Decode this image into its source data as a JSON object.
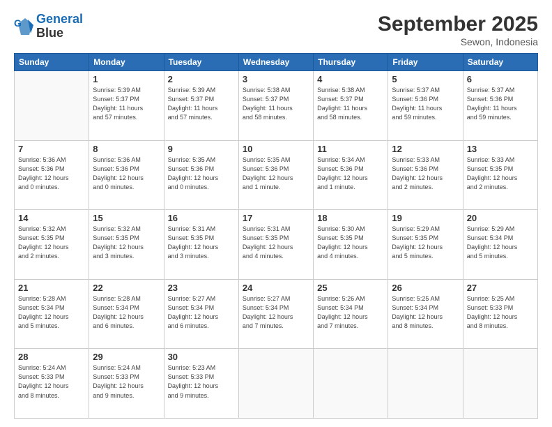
{
  "header": {
    "logo_line1": "General",
    "logo_line2": "Blue",
    "month": "September 2025",
    "location": "Sewon, Indonesia"
  },
  "weekdays": [
    "Sunday",
    "Monday",
    "Tuesday",
    "Wednesday",
    "Thursday",
    "Friday",
    "Saturday"
  ],
  "weeks": [
    [
      {
        "day": "",
        "info": ""
      },
      {
        "day": "1",
        "info": "Sunrise: 5:39 AM\nSunset: 5:37 PM\nDaylight: 11 hours\nand 57 minutes."
      },
      {
        "day": "2",
        "info": "Sunrise: 5:39 AM\nSunset: 5:37 PM\nDaylight: 11 hours\nand 57 minutes."
      },
      {
        "day": "3",
        "info": "Sunrise: 5:38 AM\nSunset: 5:37 PM\nDaylight: 11 hours\nand 58 minutes."
      },
      {
        "day": "4",
        "info": "Sunrise: 5:38 AM\nSunset: 5:37 PM\nDaylight: 11 hours\nand 58 minutes."
      },
      {
        "day": "5",
        "info": "Sunrise: 5:37 AM\nSunset: 5:36 PM\nDaylight: 11 hours\nand 59 minutes."
      },
      {
        "day": "6",
        "info": "Sunrise: 5:37 AM\nSunset: 5:36 PM\nDaylight: 11 hours\nand 59 minutes."
      }
    ],
    [
      {
        "day": "7",
        "info": "Sunrise: 5:36 AM\nSunset: 5:36 PM\nDaylight: 12 hours\nand 0 minutes."
      },
      {
        "day": "8",
        "info": "Sunrise: 5:36 AM\nSunset: 5:36 PM\nDaylight: 12 hours\nand 0 minutes."
      },
      {
        "day": "9",
        "info": "Sunrise: 5:35 AM\nSunset: 5:36 PM\nDaylight: 12 hours\nand 0 minutes."
      },
      {
        "day": "10",
        "info": "Sunrise: 5:35 AM\nSunset: 5:36 PM\nDaylight: 12 hours\nand 1 minute."
      },
      {
        "day": "11",
        "info": "Sunrise: 5:34 AM\nSunset: 5:36 PM\nDaylight: 12 hours\nand 1 minute."
      },
      {
        "day": "12",
        "info": "Sunrise: 5:33 AM\nSunset: 5:36 PM\nDaylight: 12 hours\nand 2 minutes."
      },
      {
        "day": "13",
        "info": "Sunrise: 5:33 AM\nSunset: 5:35 PM\nDaylight: 12 hours\nand 2 minutes."
      }
    ],
    [
      {
        "day": "14",
        "info": "Sunrise: 5:32 AM\nSunset: 5:35 PM\nDaylight: 12 hours\nand 2 minutes."
      },
      {
        "day": "15",
        "info": "Sunrise: 5:32 AM\nSunset: 5:35 PM\nDaylight: 12 hours\nand 3 minutes."
      },
      {
        "day": "16",
        "info": "Sunrise: 5:31 AM\nSunset: 5:35 PM\nDaylight: 12 hours\nand 3 minutes."
      },
      {
        "day": "17",
        "info": "Sunrise: 5:31 AM\nSunset: 5:35 PM\nDaylight: 12 hours\nand 4 minutes."
      },
      {
        "day": "18",
        "info": "Sunrise: 5:30 AM\nSunset: 5:35 PM\nDaylight: 12 hours\nand 4 minutes."
      },
      {
        "day": "19",
        "info": "Sunrise: 5:29 AM\nSunset: 5:35 PM\nDaylight: 12 hours\nand 5 minutes."
      },
      {
        "day": "20",
        "info": "Sunrise: 5:29 AM\nSunset: 5:34 PM\nDaylight: 12 hours\nand 5 minutes."
      }
    ],
    [
      {
        "day": "21",
        "info": "Sunrise: 5:28 AM\nSunset: 5:34 PM\nDaylight: 12 hours\nand 5 minutes."
      },
      {
        "day": "22",
        "info": "Sunrise: 5:28 AM\nSunset: 5:34 PM\nDaylight: 12 hours\nand 6 minutes."
      },
      {
        "day": "23",
        "info": "Sunrise: 5:27 AM\nSunset: 5:34 PM\nDaylight: 12 hours\nand 6 minutes."
      },
      {
        "day": "24",
        "info": "Sunrise: 5:27 AM\nSunset: 5:34 PM\nDaylight: 12 hours\nand 7 minutes."
      },
      {
        "day": "25",
        "info": "Sunrise: 5:26 AM\nSunset: 5:34 PM\nDaylight: 12 hours\nand 7 minutes."
      },
      {
        "day": "26",
        "info": "Sunrise: 5:25 AM\nSunset: 5:34 PM\nDaylight: 12 hours\nand 8 minutes."
      },
      {
        "day": "27",
        "info": "Sunrise: 5:25 AM\nSunset: 5:33 PM\nDaylight: 12 hours\nand 8 minutes."
      }
    ],
    [
      {
        "day": "28",
        "info": "Sunrise: 5:24 AM\nSunset: 5:33 PM\nDaylight: 12 hours\nand 8 minutes."
      },
      {
        "day": "29",
        "info": "Sunrise: 5:24 AM\nSunset: 5:33 PM\nDaylight: 12 hours\nand 9 minutes."
      },
      {
        "day": "30",
        "info": "Sunrise: 5:23 AM\nSunset: 5:33 PM\nDaylight: 12 hours\nand 9 minutes."
      },
      {
        "day": "",
        "info": ""
      },
      {
        "day": "",
        "info": ""
      },
      {
        "day": "",
        "info": ""
      },
      {
        "day": "",
        "info": ""
      }
    ]
  ]
}
